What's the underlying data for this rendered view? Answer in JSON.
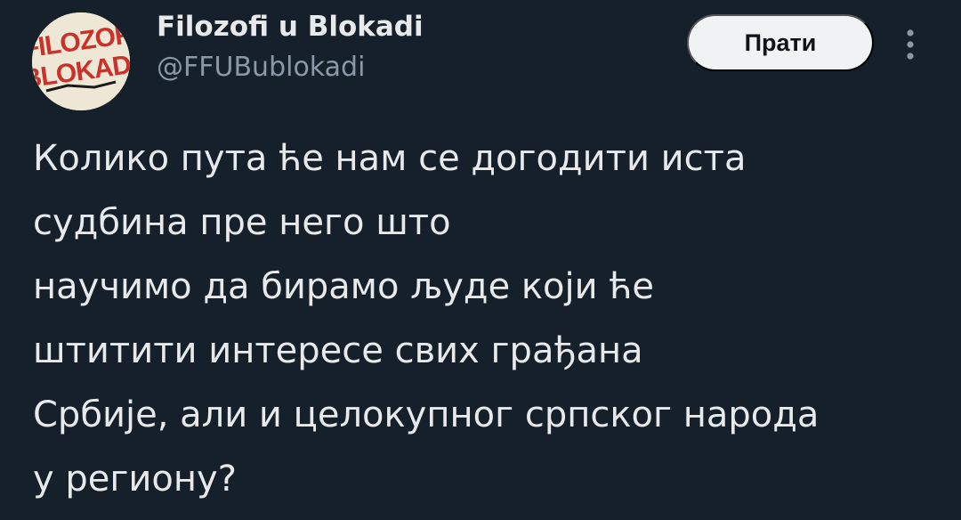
{
  "author": {
    "name": "Filozofi u Blokadi",
    "handle": "@FFUBublokadi",
    "avatar_text": [
      "FILOZOFI",
      "BLOKADI"
    ]
  },
  "actions": {
    "follow_label": "Прати",
    "more_icon": "more-vertical-icon"
  },
  "tweet": {
    "text": "Колико пута ће нам се догодити иста\nсудбина пре него што\nнаучимо да бирамо људе који ће\nштитити интересе свих грађана\nСрбије, али и целокупног српског народа\nу региону?"
  },
  "colors": {
    "background": "#15202b",
    "text": "#e7e9ea",
    "secondary_text": "#8b98a5",
    "button_background": "#eff3f4",
    "logo_red": "#c8322b"
  }
}
